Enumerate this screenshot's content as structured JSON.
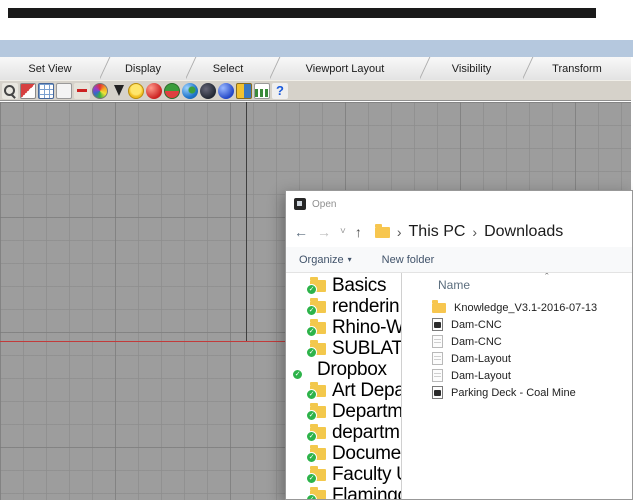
{
  "colors": {
    "title_strip": "#1a1a1a",
    "menu_bar": "#b5c8de",
    "viewport_bg": "#9d9d9d",
    "x_axis": "#c23b3b",
    "y_axis": "#3f3f3f",
    "dropbox_blue": "#0061fe",
    "sync_green": "#2db34a",
    "folder_yellow": "#f7c64f"
  },
  "window": {
    "tabs": [
      "Set View",
      "Display",
      "Select",
      "Viewport Layout",
      "Visibility",
      "Transform"
    ],
    "toolbar": {
      "icons": [
        "zoom-icon",
        "clipping-plane-icon",
        "grid-table-icon",
        "page-icon",
        "remove-icon",
        "palette-icon",
        "cursor-icon",
        "light-icon",
        "material-red-icon",
        "material-melon-icon",
        "earth-icon",
        "earth-dark-icon",
        "material-blue-icon",
        "blocks-icon",
        "chart-icon",
        "help-icon"
      ],
      "help_glyph": "?"
    }
  },
  "dialog": {
    "title": "Open",
    "nav": {
      "back": "←",
      "forward": "→",
      "dropdown": "˅",
      "up": "↑"
    },
    "breadcrumb": {
      "separator": "›",
      "items": [
        "This PC",
        "Downloads"
      ]
    },
    "commands": {
      "organize": "Organize",
      "organize_caret": "▾",
      "new_folder": "New folder"
    },
    "tree": [
      {
        "label": "Basics"
      },
      {
        "label": "renderin"
      },
      {
        "label": "Rhino-W"
      },
      {
        "label": "SUBLATI"
      },
      {
        "label": "Dropbox"
      },
      {
        "label": "Art Depa"
      },
      {
        "label": "Departm"
      },
      {
        "label": "departm"
      },
      {
        "label": "Docume"
      },
      {
        "label": "Faculty U"
      },
      {
        "label": "Flamingo"
      }
    ],
    "files": {
      "column_header": "Name",
      "sort_indicator": "ˆ",
      "items": [
        {
          "name": "Knowledge_V3.1-2016-07-13",
          "type": "folder"
        },
        {
          "name": "Dam-CNC",
          "type": "rhino"
        },
        {
          "name": "Dam-CNC",
          "type": "doc"
        },
        {
          "name": "Dam-Layout",
          "type": "doc"
        },
        {
          "name": "Dam-Layout",
          "type": "doc"
        },
        {
          "name": "Parking Deck - Coal Mine",
          "type": "rhino"
        }
      ]
    }
  }
}
